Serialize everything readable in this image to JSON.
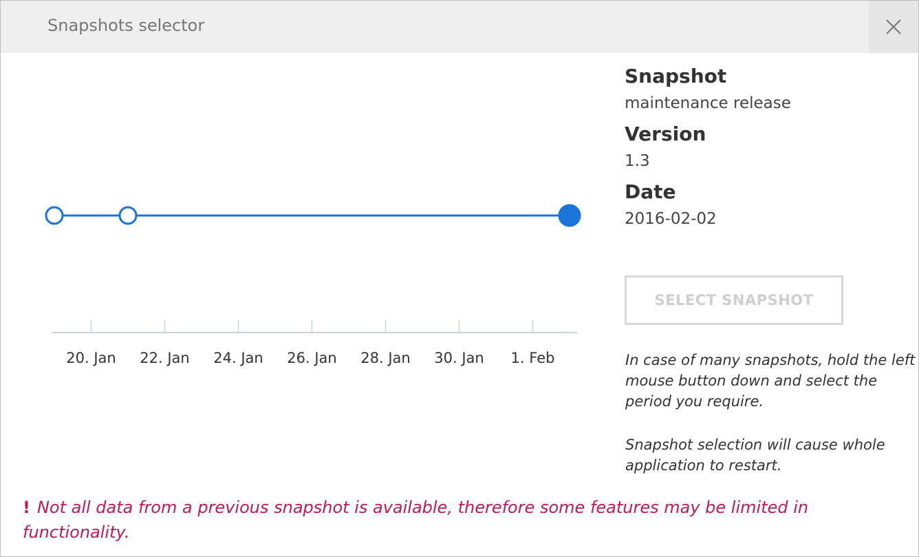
{
  "dialog": {
    "title": "Snapshots selector",
    "close_icon": "close-icon"
  },
  "chart_data": {
    "type": "scatter",
    "x": [
      "2016-01-19",
      "2016-01-21",
      "2016-02-02"
    ],
    "y": [
      0,
      0,
      0
    ],
    "selected_index": 2,
    "x_tick_labels": [
      "20. Jan",
      "22. Jan",
      "24. Jan",
      "26. Jan",
      "28. Jan",
      "30. Jan",
      "1. Feb"
    ],
    "xlim": [
      "2016-01-19",
      "2016-02-02"
    ],
    "grid": false,
    "line_color": "#1a73d9",
    "title": "",
    "xlabel": "",
    "ylabel": ""
  },
  "info": {
    "snapshot_label": "Snapshot",
    "snapshot_value": "maintenance release",
    "version_label": "Version",
    "version_value": "1.3",
    "date_label": "Date",
    "date_value": "2016-02-02"
  },
  "select_button": {
    "label": "SELECT SNAPSHOT",
    "enabled": false
  },
  "hints": {
    "selection": "In case of many snapshots, hold the left mouse button down and select the period you require.",
    "restart": "Snapshot selection will cause whole application to restart."
  },
  "warning": {
    "icon": "exclamation-icon",
    "symbol": "!",
    "text": "Not all data from a previous snapshot is available, therefore some features may be limited in functionality."
  },
  "colors": {
    "accent": "#1a73d9",
    "warning": "#c2185b"
  }
}
